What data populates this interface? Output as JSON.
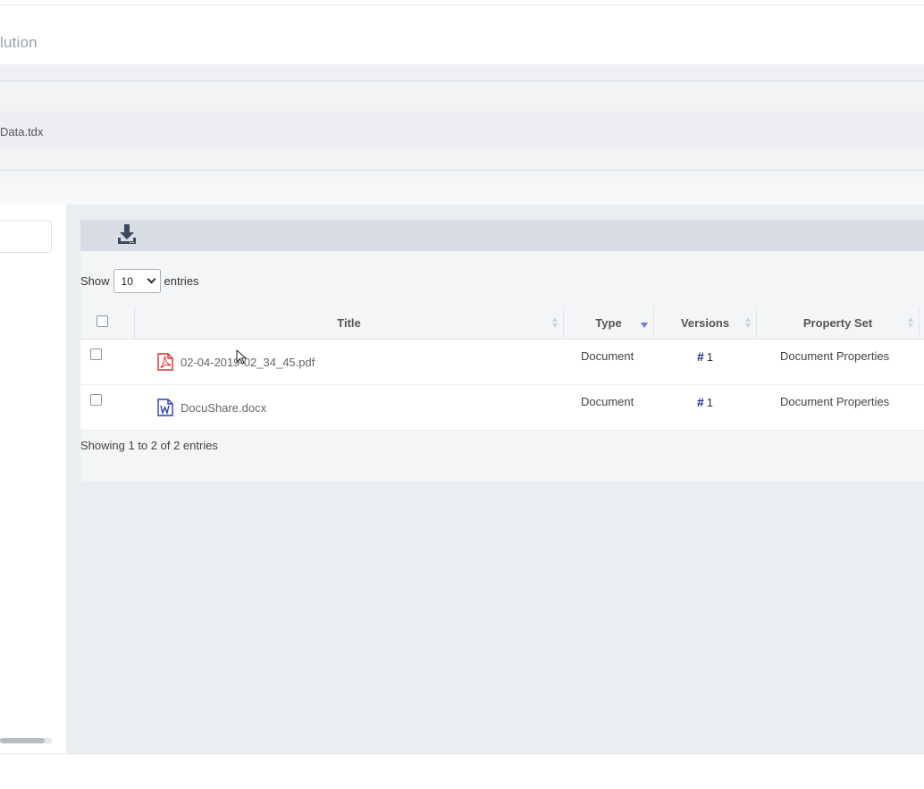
{
  "header": {
    "title": "lution"
  },
  "breadcrumb": {
    "file": "Data.tdx"
  },
  "toolbar": {
    "download_icon": "download-icon"
  },
  "table": {
    "length_prefix": "Show",
    "length_value": "10",
    "length_suffix": "entries",
    "columns": [
      "Title",
      "Type",
      "Versions",
      "Property Set"
    ],
    "rows": [
      {
        "icon": "pdf-file-icon",
        "title": "02-04-2019-02_34_45.pdf",
        "type": "Document",
        "version_symbol": "#",
        "version": "1",
        "property_set": "Document Properties"
      },
      {
        "icon": "word-file-icon",
        "title": "DocuShare.docx",
        "type": "Document",
        "version_symbol": "#",
        "version": "1",
        "property_set": "Document Properties"
      }
    ],
    "info": "Showing 1 to 2 of 2 entries"
  },
  "colors": {
    "pdf": "#d9302c",
    "word": "#2b3fb3",
    "sort_active": "#6f7bd8",
    "version_hash": "#1a2a8c"
  }
}
